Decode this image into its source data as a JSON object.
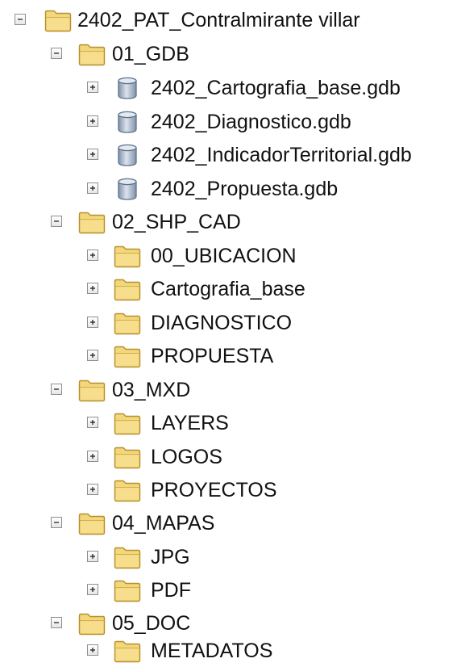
{
  "root": {
    "label": "2402_PAT_Contralmirante villar",
    "expanded": true,
    "icon": "folder-icon",
    "children": [
      {
        "label": "01_GDB",
        "expanded": true,
        "icon": "folder-icon",
        "children": [
          {
            "label": "2402_Cartografia_base.gdb",
            "icon": "geodatabase-icon",
            "expanded": false
          },
          {
            "label": "2402_Diagnostico.gdb",
            "icon": "geodatabase-icon",
            "expanded": false
          },
          {
            "label": "2402_IndicadorTerritorial.gdb",
            "icon": "geodatabase-icon",
            "expanded": false
          },
          {
            "label": "2402_Propuesta.gdb",
            "icon": "geodatabase-icon",
            "expanded": false
          }
        ]
      },
      {
        "label": "02_SHP_CAD",
        "expanded": true,
        "icon": "folder-icon",
        "children": [
          {
            "label": "00_UBICACION",
            "icon": "folder-icon",
            "expanded": false
          },
          {
            "label": "Cartografia_base",
            "icon": "folder-icon",
            "expanded": false
          },
          {
            "label": "DIAGNOSTICO",
            "icon": "folder-icon",
            "expanded": false
          },
          {
            "label": "PROPUESTA",
            "icon": "folder-icon",
            "expanded": false
          }
        ]
      },
      {
        "label": "03_MXD",
        "expanded": true,
        "icon": "folder-icon",
        "children": [
          {
            "label": "LAYERS",
            "icon": "folder-icon",
            "expanded": false
          },
          {
            "label": "LOGOS",
            "icon": "folder-icon",
            "expanded": false
          },
          {
            "label": "PROYECTOS",
            "icon": "folder-icon",
            "expanded": false
          }
        ]
      },
      {
        "label": "04_MAPAS",
        "expanded": true,
        "icon": "folder-icon",
        "children": [
          {
            "label": "JPG",
            "icon": "folder-icon",
            "expanded": false
          },
          {
            "label": "PDF",
            "icon": "folder-icon",
            "expanded": false
          }
        ]
      },
      {
        "label": "05_DOC",
        "expanded": true,
        "icon": "folder-icon",
        "children": [
          {
            "label": "METADATOS",
            "icon": "folder-icon",
            "expanded": false
          }
        ]
      }
    ]
  },
  "colors": {
    "folder_fill": "#f3d77c",
    "folder_edge": "#b8902c",
    "gdb_fill": "#a9b9cc",
    "gdb_edge": "#5f7288"
  }
}
